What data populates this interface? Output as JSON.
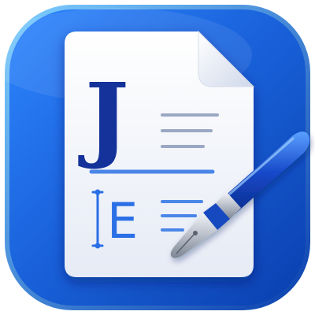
{
  "app_icon": {
    "name": "document-editor-app-icon",
    "monogram": "J",
    "cursor_letter": "E",
    "colors": {
      "tile_dark": "#0a3fae",
      "tile_mid": "#1a63dc",
      "tile_light": "#2f86ff",
      "tile_rim": "#4fb0ff",
      "page": "#f4f6fb",
      "page_shadow": "#c9d3e6",
      "monogram": "#14329a",
      "text_lines": "#9aa8c4",
      "accent_lines": "#4a86e8",
      "cursor_letter": "#2a6fe6",
      "pen_body": "#1648c8",
      "pen_highlight": "#5aa0ff",
      "pen_silver": "#c9cdd6",
      "nib": "#aeb4bf"
    }
  }
}
